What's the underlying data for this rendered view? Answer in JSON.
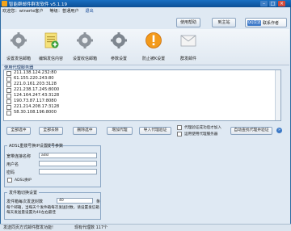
{
  "window": {
    "title": "智能群邮件群发软件 v5.1.19",
    "controls": [
      "–",
      "□",
      "×"
    ]
  },
  "userbar": {
    "greeting": "欢迎您：",
    "username": "winerte客户",
    "level": "等级：普通用户",
    "logout": "退出"
  },
  "top_buttons": {
    "help": "使用帮助",
    "register": "到主站",
    "qq_badge": "QQ交流",
    "qq_text": "联系作者"
  },
  "toolbar": [
    {
      "label": "设置发信邮箱",
      "icon": "gear-mail-icon"
    },
    {
      "label": "编辑发信内容",
      "icon": "document-edit-icon"
    },
    {
      "label": "设置收信邮箱",
      "icon": "gear-mail-icon"
    },
    {
      "label": "参数设置",
      "icon": "gear-icon"
    },
    {
      "label": "防止被K设置",
      "icon": "warning-icon"
    },
    {
      "label": "群发邮件",
      "icon": "envelope-icon"
    }
  ],
  "proxy_list": {
    "title": "使用代理服务器",
    "items": [
      "211.138.124.232:80",
      "61.155.220.243:80",
      "221.0.161.203:3128",
      "221.238.17.245:8000",
      "124.164.247.43:3128",
      "190.73.87.117:8080",
      "221.214.208.17:3128",
      "58.30.108.196:8000"
    ]
  },
  "action_buttons": {
    "select_all": "全部选中",
    "deselect_all": "全部去除",
    "delete_selected": "删除选中",
    "add_proxy": "增加代理",
    "import_verify": "导入代理验证",
    "auto_verify": "自动查找代理并验证"
  },
  "proxy_options": {
    "verify_success_only": "代理验证成功后才加入",
    "skip_unverified": "运用使用代理服务器"
  },
  "adsl": {
    "title": "ADSL重拨号换IP设置",
    "subtitle": "拨号参数",
    "conn_label": "宽带连接名称",
    "conn_value": "adsl",
    "user_label": "用户名",
    "user_value": "",
    "pass_label": "密码",
    "pass_value": "",
    "enable_label": "ADSL换IP"
  },
  "mailer": {
    "title": "发件箱切换设置",
    "count_label": "发件箱每次发送封数",
    "count_value": "40",
    "count_unit": "条",
    "note": "每个邮箱，当每天个发件箱每次发送封数，请设置发信箱每天发送量设置为40左右最佳"
  },
  "status": {
    "left": "发送同页方式邮件群发功能!",
    "right": "现有代理数 117个"
  }
}
